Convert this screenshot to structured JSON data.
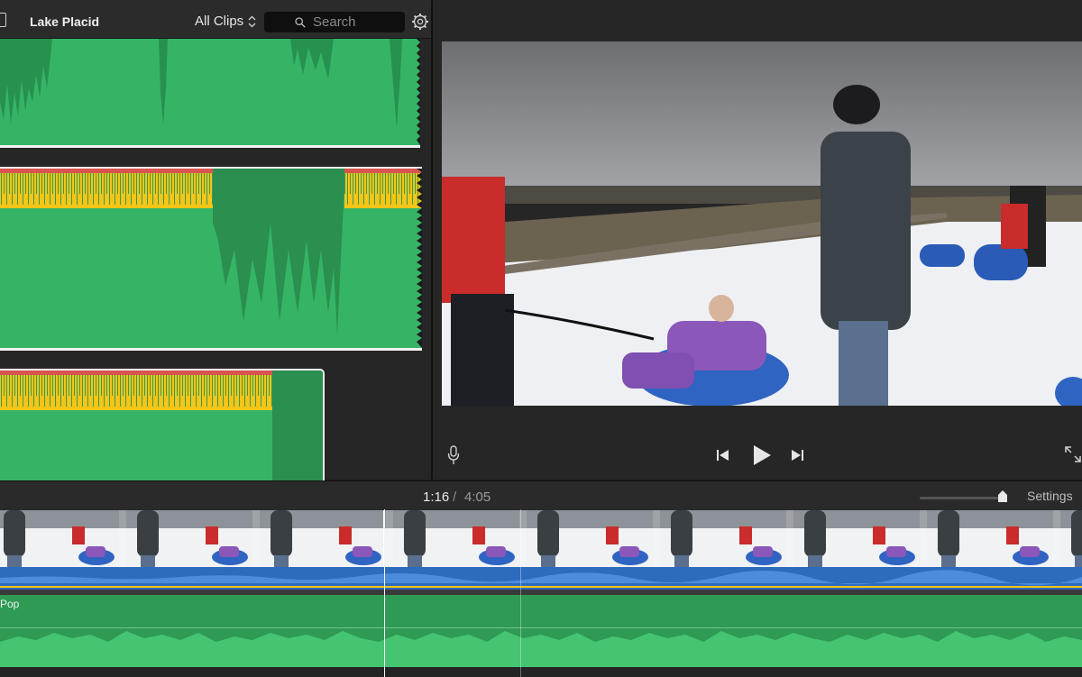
{
  "browser": {
    "library_title": "Lake Placid",
    "filter": "All Clips",
    "search_placeholder": "Search"
  },
  "timeline": {
    "current_time": "1:16",
    "separator": "/",
    "total_time": "4:05",
    "settings_label": "Settings",
    "music_track_label": "Pop",
    "zoom_level": 0.97
  },
  "colors": {
    "audio_green": "#35b466",
    "audio_dark_green": "#2a8f4f",
    "peak_yellow": "#f5c518",
    "peak_red": "#d9534f",
    "clip_audio_blue": "#2d6bbd",
    "music_green": "#2e9a54"
  },
  "icons": {
    "sidebar": "sidebar-toggle-icon",
    "search": "search-icon",
    "gear": "gear-icon",
    "mic": "microphone-icon",
    "prev": "skip-back-icon",
    "play": "play-icon",
    "next": "skip-forward-icon",
    "fullscreen": "fullscreen-icon"
  }
}
